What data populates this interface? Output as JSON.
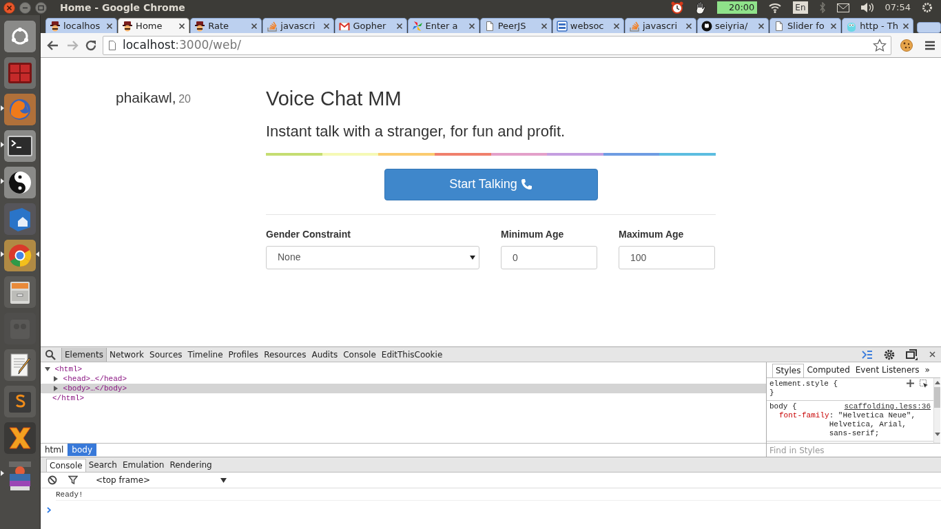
{
  "desktop_bar": {
    "window_title": "Home - Google Chrome",
    "timer": "20:00",
    "keyboard": "En",
    "clock": "07:54"
  },
  "launcher": [
    {
      "running": false,
      "focused": false
    },
    {
      "running": false,
      "focused": false
    },
    {
      "running": true,
      "focused": false
    },
    {
      "running": true,
      "focused": false
    },
    {
      "running": true,
      "focused": false
    },
    {
      "running": false,
      "focused": false
    },
    {
      "running": true,
      "focused": true
    },
    {
      "running": false,
      "focused": false
    },
    {
      "running": false,
      "focused": false
    },
    {
      "running": false,
      "focused": false
    },
    {
      "running": false,
      "focused": false
    },
    {
      "running": false,
      "focused": false
    },
    {
      "running": true,
      "focused": false
    }
  ],
  "browser": {
    "tabs": [
      {
        "kind": "hat",
        "title": "localhos",
        "selected": false
      },
      {
        "kind": "hat",
        "title": "Home",
        "selected": true
      },
      {
        "kind": "hat",
        "title": "Rate",
        "selected": false
      },
      {
        "kind": "stack",
        "title": "javascri",
        "selected": false
      },
      {
        "kind": "mail",
        "title": "Gopher",
        "selected": false
      },
      {
        "kind": "pinwheel",
        "title": "Enter a",
        "selected": false
      },
      {
        "kind": "page",
        "title": "PeerJS",
        "selected": false
      },
      {
        "kind": "doc",
        "title": "websoc",
        "selected": false
      },
      {
        "kind": "stack",
        "title": "javascri",
        "selected": false
      },
      {
        "kind": "octocat",
        "title": "seiyria/",
        "selected": false
      },
      {
        "kind": "page",
        "title": "Slider fo",
        "selected": false
      },
      {
        "kind": "gopher",
        "title": "http - Th",
        "selected": false
      }
    ],
    "forward_disabled": true,
    "address": {
      "host": "localhost",
      "path": ":3000/web/"
    }
  },
  "page": {
    "user": {
      "name": "phaikawl,",
      "age": "20"
    },
    "title": "Voice Chat MM",
    "tagline": "Instant talk with a stranger, for fun and profit.",
    "stripe": [
      {
        "color": "#c5dd72"
      },
      {
        "color": "#f5f9b5"
      },
      {
        "color": "#fbcb6f"
      },
      {
        "color": "#f0806c"
      },
      {
        "color": "#e3a0c9"
      },
      {
        "color": "#c59ee0"
      },
      {
        "color": "#6e9ce2"
      },
      {
        "color": "#5cbde0"
      }
    ],
    "start_button": "Start Talking",
    "filters": [
      {
        "kind": "select",
        "label": "Gender Constraint",
        "value": "None"
      },
      {
        "kind": "number",
        "label": "Minimum Age",
        "value": "0"
      },
      {
        "kind": "number",
        "label": "Maximum Age",
        "value": "100"
      }
    ]
  },
  "devtools": {
    "panels": [
      {
        "label": "Elements",
        "selected": true
      },
      {
        "label": "Network",
        "selected": false
      },
      {
        "label": "Sources",
        "selected": false
      },
      {
        "label": "Timeline",
        "selected": false
      },
      {
        "label": "Profiles",
        "selected": false
      },
      {
        "label": "Resources",
        "selected": false
      },
      {
        "label": "Audits",
        "selected": false
      },
      {
        "label": "Console",
        "selected": false
      },
      {
        "label": "EditThisCookie",
        "selected": false
      }
    ],
    "dom": [
      {
        "text": "<html>",
        "expanded": true,
        "selected": false,
        "closing": "</html>",
        "children": [
          {
            "text": "<head>…</head>",
            "expanded": false,
            "selected": false
          },
          {
            "text": "<body>…</body>",
            "expanded": false,
            "selected": true
          }
        ]
      }
    ],
    "breadcrumbs": [
      {
        "label": "html",
        "selected": false
      },
      {
        "label": "body",
        "selected": true
      }
    ],
    "sidebar_tabs": [
      {
        "label": "Styles",
        "selected": true
      },
      {
        "label": "Computed",
        "selected": false
      },
      {
        "label": "Event Listeners",
        "selected": false
      }
    ],
    "sidebar_more": "»",
    "styles": [
      {
        "selector": "element.style {",
        "closing": "}"
      },
      {
        "selector": "body {",
        "source": "scaffolding.less:36",
        "properties": [
          {
            "name": "font-family",
            "value": ": \"Helvetica Neue\", Helvetica, Arial, sans-serif;"
          }
        ]
      }
    ],
    "find_placeholder": "Find in Styles",
    "drawer_tabs": [
      {
        "label": "Console",
        "selected": true
      },
      {
        "label": "Search",
        "selected": false
      },
      {
        "label": "Emulation",
        "selected": false
      },
      {
        "label": "Rendering",
        "selected": false
      }
    ],
    "frame_select": "<top frame>",
    "console_lines": [
      "Ready!"
    ]
  }
}
